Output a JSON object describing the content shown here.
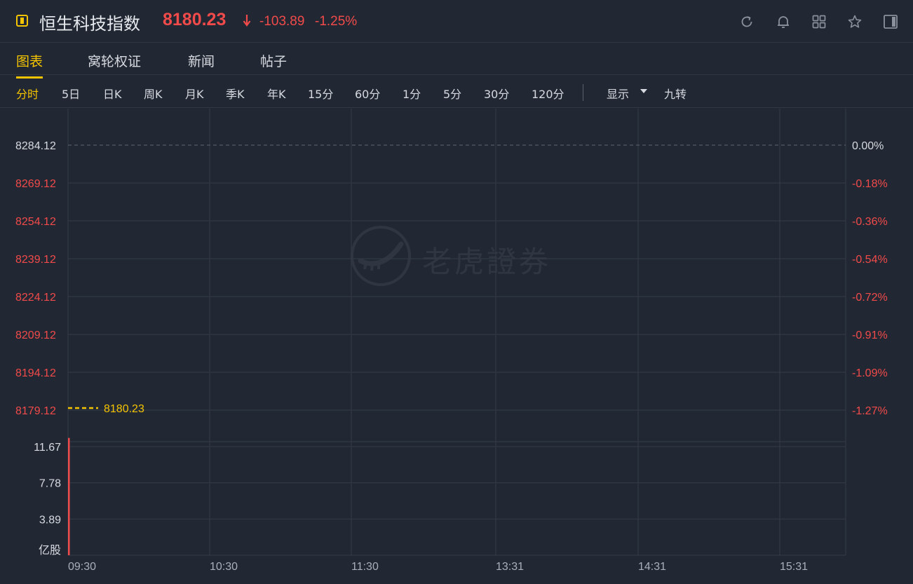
{
  "header": {
    "title": "恒生科技指数",
    "price": "8180.23",
    "change": "-103.89",
    "change_pct": "-1.25%",
    "colors": {
      "down": "#f14a4a",
      "accent": "#f5c400"
    },
    "icons": [
      "refresh-icon",
      "bell-icon",
      "grid-icon",
      "star-icon",
      "panel-icon"
    ]
  },
  "tabs": [
    {
      "label": "图表",
      "active": true
    },
    {
      "label": "窝轮权证",
      "active": false
    },
    {
      "label": "新闻",
      "active": false
    },
    {
      "label": "帖子",
      "active": false
    }
  ],
  "periods": [
    {
      "label": "分时",
      "active": true
    },
    {
      "label": "5日"
    },
    {
      "label": "日K"
    },
    {
      "label": "周K"
    },
    {
      "label": "月K"
    },
    {
      "label": "季K"
    },
    {
      "label": "年K"
    },
    {
      "label": "15分"
    },
    {
      "label": "60分"
    },
    {
      "label": "1分"
    },
    {
      "label": "5分"
    },
    {
      "label": "30分"
    },
    {
      "label": "120分"
    }
  ],
  "display_menu": {
    "label": "显示",
    "nine_turn": "九转"
  },
  "watermark": "老虎證券",
  "chart_data": {
    "type": "line",
    "price_axis": {
      "ticks": [
        8284.12,
        8269.12,
        8254.12,
        8239.12,
        8224.12,
        8209.12,
        8194.12,
        8179.12
      ],
      "tick_labels": [
        "8284.12",
        "8269.12",
        "8254.12",
        "8239.12",
        "8224.12",
        "8209.12",
        "8194.12",
        "8179.12"
      ],
      "prev_close": 8284.12
    },
    "percent_axis": {
      "tick_labels": [
        "0.00%",
        "-0.18%",
        "-0.36%",
        "-0.54%",
        "-0.72%",
        "-0.91%",
        "-1.09%",
        "-1.27%"
      ]
    },
    "current_price": 8180.23,
    "current_price_label": "8180.23",
    "volume_axis": {
      "ticks": [
        11.67,
        7.78,
        3.89
      ],
      "tick_labels": [
        "11.67",
        "7.78",
        "3.89"
      ],
      "unit": "亿股",
      "max": 13.1
    },
    "volume_bars": [
      {
        "time": "09:30",
        "value": 12.6
      }
    ],
    "time_axis": {
      "labels": [
        "09:30",
        "10:30",
        "11:30",
        "13:31",
        "14:31",
        "15:31"
      ]
    },
    "grid": true
  }
}
